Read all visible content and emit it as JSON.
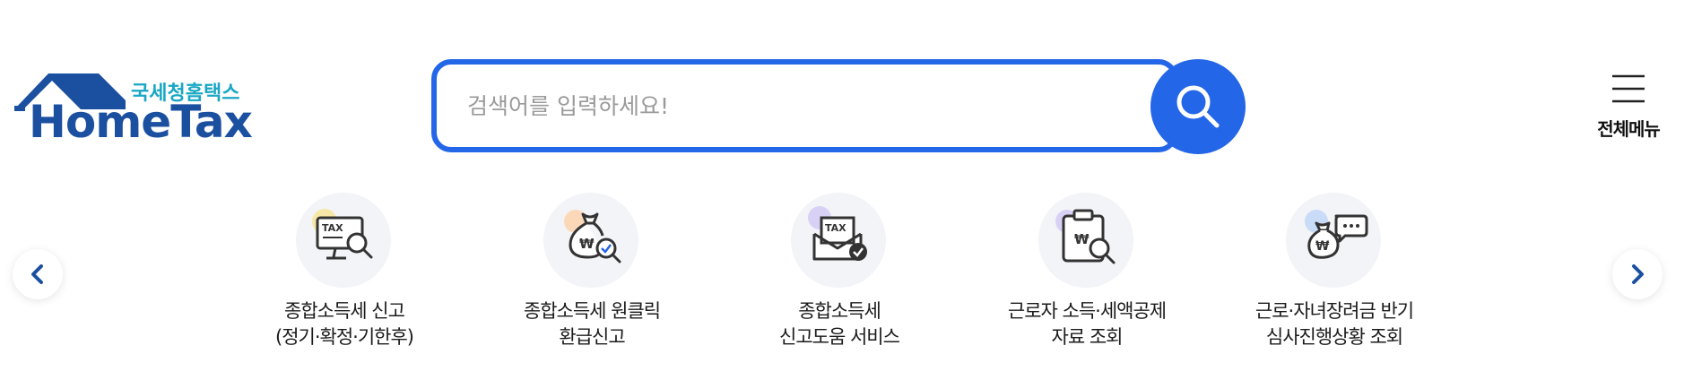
{
  "logo": {
    "korean": "국세청홈택스",
    "english": "HomeTax"
  },
  "search": {
    "placeholder": "검색어를 입력하세요!",
    "value": ""
  },
  "menu": {
    "label": "전체메뉴"
  },
  "services": [
    {
      "line1": "종합소득세 신고",
      "line2": "(정기·확정·기한후)",
      "icon": "tax-monitor-search-icon"
    },
    {
      "line1": "종합소득세 원클릭",
      "line2": "환급신고",
      "icon": "money-bag-search-icon"
    },
    {
      "line1": "종합소득세",
      "line2": "신고도움 서비스",
      "icon": "tax-envelope-check-icon"
    },
    {
      "line1": "근로자 소득·세액공제",
      "line2": "자료 조회",
      "icon": "clipboard-search-icon"
    },
    {
      "line1": "근로·자녀장려금 반기",
      "line2": "심사진행상황 조회",
      "icon": "money-bag-chat-icon"
    }
  ],
  "colors": {
    "brand_blue": "#1b4fa0",
    "brand_teal": "#19a7c4",
    "accent_blue": "#2466e8"
  }
}
